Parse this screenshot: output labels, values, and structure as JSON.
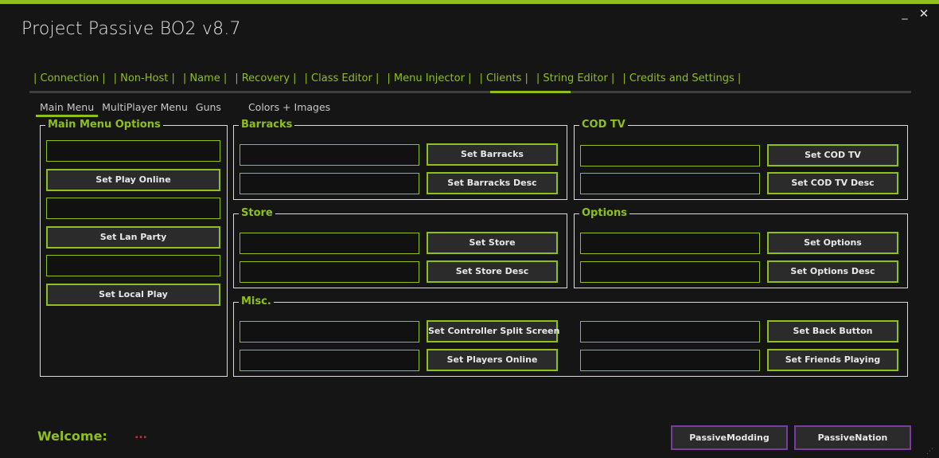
{
  "app": {
    "title": "Project Passive BO2 v8.7",
    "minimize_glyph": "_",
    "close_glyph": "✕"
  },
  "tabs": [
    {
      "label": "| Connection |"
    },
    {
      "label": "| Non-Host |"
    },
    {
      "label": "| Name |"
    },
    {
      "label": "| Recovery |"
    },
    {
      "label": "| Class Editor |"
    },
    {
      "label": "| Menu Injector |"
    },
    {
      "label": "| Clients |"
    },
    {
      "label": "| String Editor |",
      "active": true
    },
    {
      "label": "| Credits and Settings |"
    }
  ],
  "subtabs": [
    {
      "label": "Main Menu",
      "active": true
    },
    {
      "label": "MultiPlayer Menu"
    },
    {
      "label": "Guns"
    },
    {
      "label": "Colors + Images"
    }
  ],
  "groups": {
    "main_menu": {
      "title": "Main Menu Options",
      "buttons": [
        "Set Play Online",
        "Set Lan Party",
        "Set Local Play"
      ]
    },
    "barracks": {
      "title": "Barracks",
      "buttons": [
        "Set Barracks",
        "Set Barracks Desc"
      ]
    },
    "codtv": {
      "title": "COD TV",
      "buttons": [
        "Set COD TV",
        "Set COD TV Desc"
      ]
    },
    "store": {
      "title": "Store",
      "buttons": [
        "Set Store",
        "Set Store Desc"
      ]
    },
    "options": {
      "title": "Options",
      "buttons": [
        "Set Options",
        "Set Options Desc"
      ]
    },
    "misc": {
      "title": "Misc.",
      "buttons": [
        "Set Controller Split Screen",
        "Set Players Online",
        "Set Back Button",
        "Set Friends Playing"
      ]
    }
  },
  "footer": {
    "welcome_label": "Welcome:",
    "username": "...",
    "link1": "PassiveModding",
    "link2": "PassiveNation"
  },
  "colors": {
    "accent": "#8fbf1a",
    "background": "#151515",
    "link_border": "#7a3a9e",
    "username": "#d1273a"
  }
}
